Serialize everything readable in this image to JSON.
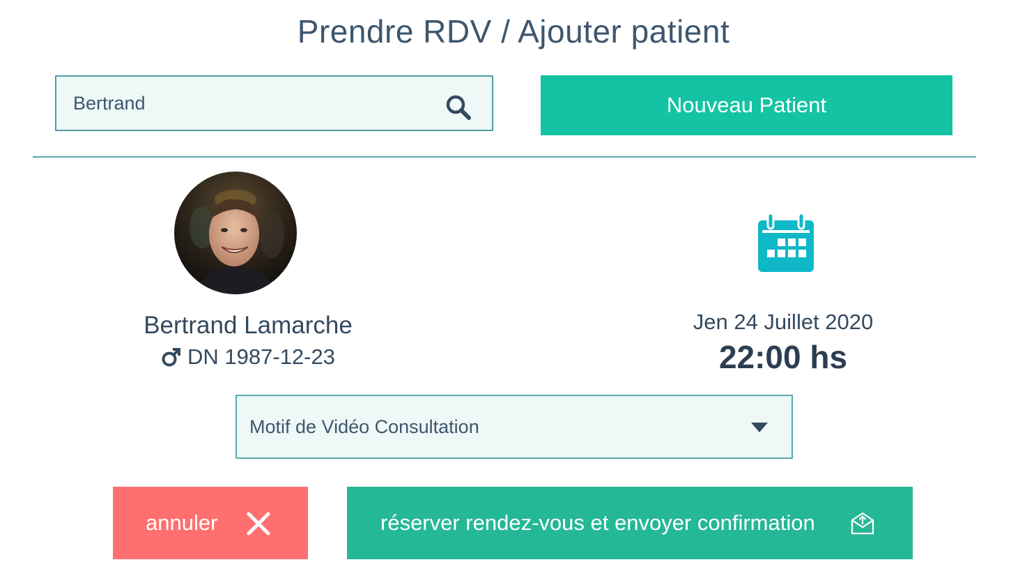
{
  "page": {
    "title": "Prendre RDV / Ajouter patient"
  },
  "search": {
    "value": "Bertrand",
    "icon": "search-icon"
  },
  "new_patient": {
    "label": "Nouveau Patient"
  },
  "patient": {
    "name": "Bertrand Lamarche",
    "gender_icon": "male-icon",
    "dob": "DN 1987-12-23"
  },
  "appointment": {
    "calendar_icon": "calendar-icon",
    "date": "Jen 24 Juillet 2020",
    "time": "22:00 hs"
  },
  "motif": {
    "selected": "Motif de Vidéo Consultation"
  },
  "actions": {
    "cancel_label": "annuler",
    "reserve_label": "réserver rendez-vous et envoyer confirmation"
  },
  "colors": {
    "title": "#3d566e",
    "accent_teal": "#13c3a3",
    "reserve_green": "#25b896",
    "cancel_red": "#ff6f6f",
    "calendar_cyan": "#0fb8c6",
    "field_bg": "#eef8f6",
    "border": "#5aa9ae"
  }
}
